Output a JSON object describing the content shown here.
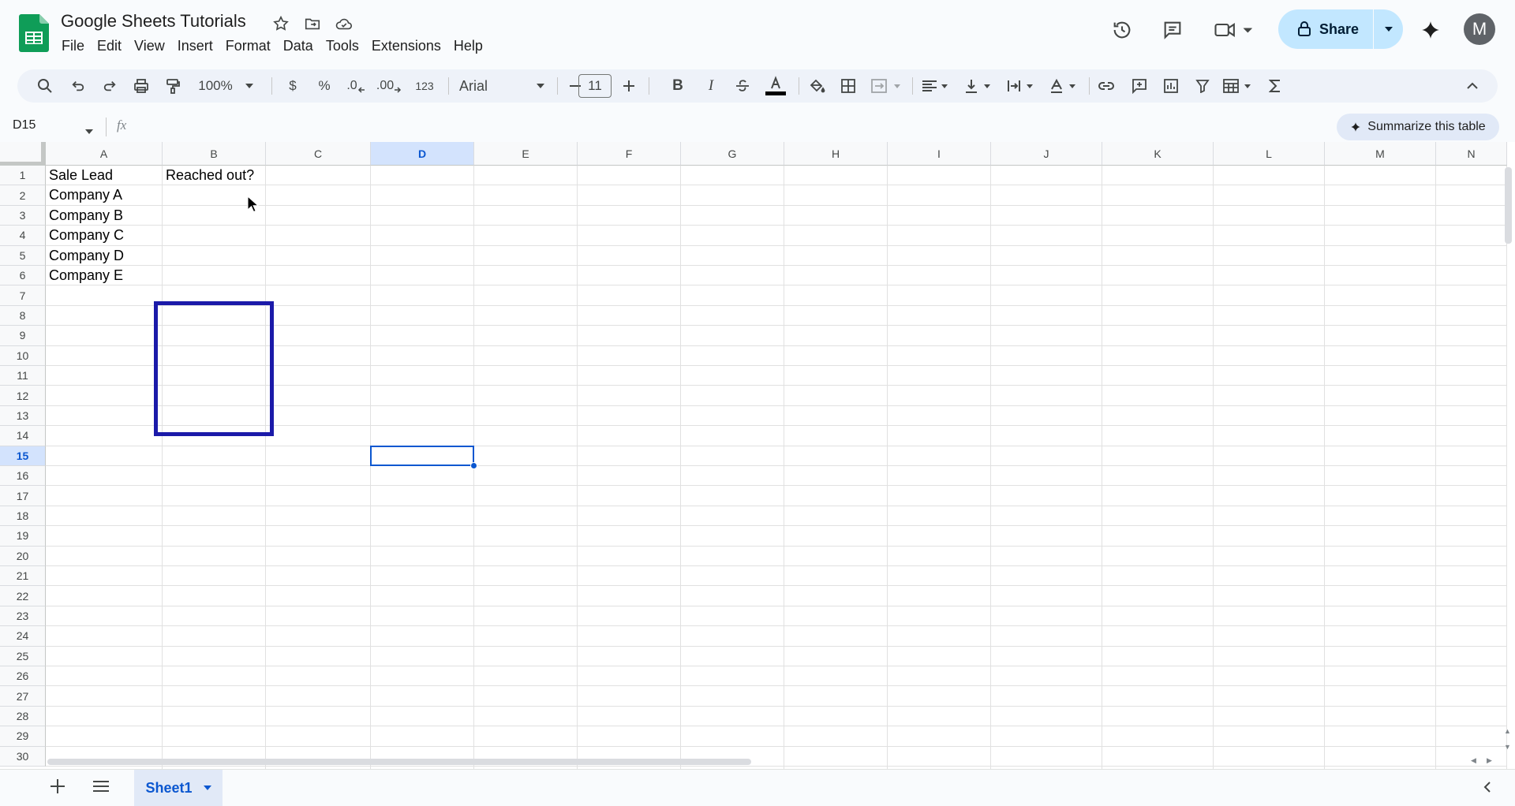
{
  "doc": {
    "title": "Google Sheets Tutorials"
  },
  "menu": [
    "File",
    "Edit",
    "View",
    "Insert",
    "Format",
    "Data",
    "Tools",
    "Extensions",
    "Help"
  ],
  "header": {
    "share_label": "Share",
    "avatar_initial": "M"
  },
  "toolbar": {
    "zoom": "100%",
    "currency": "$",
    "percent": "%",
    "decrease_decimal": ".0",
    "increase_decimal": ".00",
    "number_format": "123",
    "font": "Arial",
    "font_size": "11",
    "bold": "B",
    "italic": "I"
  },
  "formula": {
    "name_box": "D15",
    "fx": "fx",
    "summarize": "Summarize this table"
  },
  "grid": {
    "columns": [
      "A",
      "B",
      "C",
      "D",
      "E",
      "F",
      "G",
      "H",
      "I",
      "J",
      "K",
      "L",
      "M",
      "N"
    ],
    "rows": [
      "1",
      "2",
      "3",
      "4",
      "5",
      "6",
      "7",
      "8",
      "9",
      "10",
      "11",
      "12",
      "13",
      "14",
      "15",
      "16",
      "17",
      "18",
      "19",
      "20",
      "21",
      "22",
      "23",
      "24",
      "25",
      "26",
      "27",
      "28",
      "29",
      "30"
    ],
    "selected_column": "D",
    "selected_row": "15",
    "cells": {
      "A1": "Sale Lead",
      "B1": "Reached out?",
      "A2": "Company A",
      "A3": "Company B",
      "A4": "Company C",
      "A5": "Company D",
      "A6": "Company E"
    }
  },
  "sheets": {
    "active": "Sheet1"
  },
  "colors": {
    "accent": "#0b57d0",
    "highlight_box": "#1b1aa9",
    "share_bg": "#c2e7ff",
    "sheets_green": "#0f9d58"
  }
}
